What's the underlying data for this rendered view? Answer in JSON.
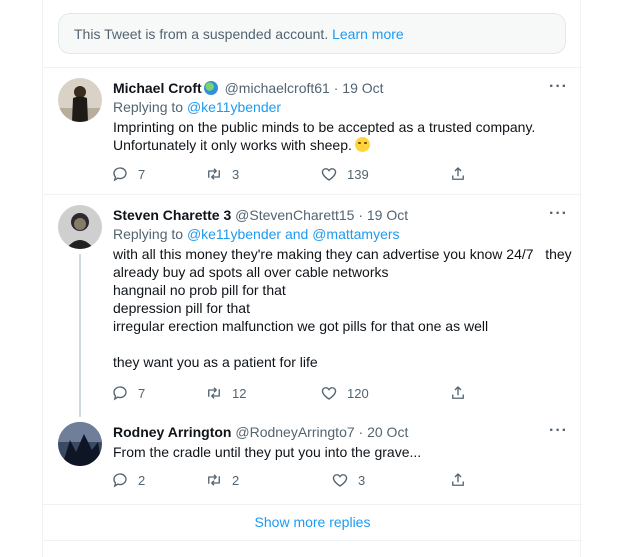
{
  "notice": {
    "text": "This Tweet is from a suspended account.",
    "link": "Learn more"
  },
  "tweets": [
    {
      "name": "Michael Croft",
      "handle": "@michaelcroft61",
      "dot_date": "· 19 Oct",
      "replying_prefix": "Replying to",
      "replying_to": "@ke11ybender",
      "lines": [
        "Imprinting on the public minds to be accepted as a trusted company.",
        "Unfortunately it only works with sheep."
      ],
      "replies": "7",
      "retweets": "3",
      "likes": "139",
      "avatar_colors": [
        "#d9d2c7",
        "#1d1a18"
      ]
    },
    {
      "name": "Steven Charette 3",
      "handle": "@StevenCharett15",
      "dot_date": "· 19 Oct",
      "replying_prefix": "Replying to",
      "replying_to": "@ke11ybender and @mattamyers",
      "lines": [
        "with all this money they're making they can advertise you know 24/7   they",
        "already buy ad spots all over cable networks",
        "hangnail no prob pill for that",
        "depression pill for that",
        "irregular erection malfunction we got pills for that one as well",
        "",
        "they want you as a patient for life"
      ],
      "replies": "7",
      "retweets": "12",
      "likes": "120",
      "avatar_colors": [
        "#cfcfcf",
        "#2b2b2b"
      ]
    },
    {
      "name": "Rodney Arrington",
      "handle": "@RodneyArringto7",
      "dot_date": "· 20 Oct",
      "lines": [
        "From the cradle until they put you into the grave..."
      ],
      "replies": "2",
      "retweets": "2",
      "likes": "3",
      "avatar_colors": [
        "#3b4a63",
        "#0e1626"
      ]
    }
  ],
  "more_menu": "···",
  "show_more": "Show more replies"
}
